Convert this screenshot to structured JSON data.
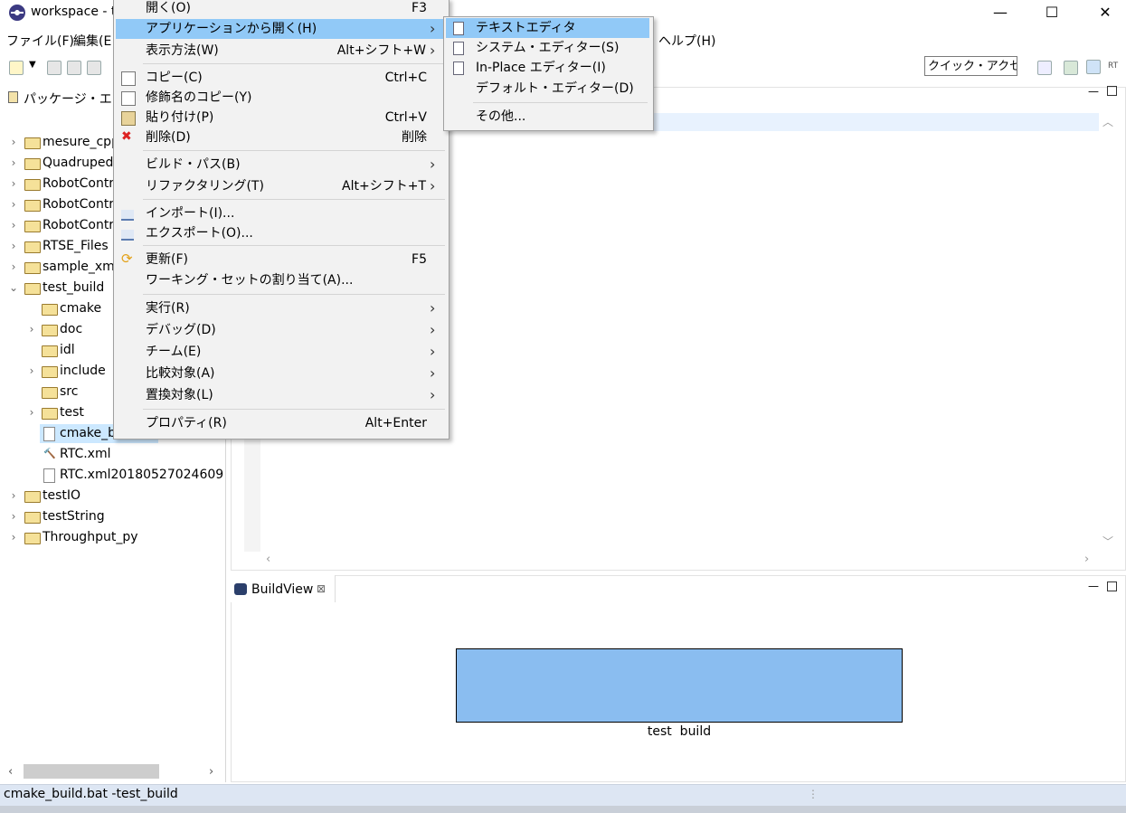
{
  "window": {
    "title": "workspace - t",
    "minimize": "—",
    "maximize": "☐",
    "close": "✕"
  },
  "menubar": {
    "items": [
      "ファイル(F)",
      "編集(E",
      "ヘルプ(H)"
    ]
  },
  "toolbar": {
    "quick_access": "クイック・アクセス"
  },
  "package_explorer": {
    "title": "パッケージ・エクス",
    "items": [
      {
        "label": "mesure_cpp",
        "type": "project"
      },
      {
        "label": "Quadruped",
        "type": "project"
      },
      {
        "label": "RobotContr",
        "type": "project"
      },
      {
        "label": "RobotContr",
        "type": "project"
      },
      {
        "label": "RobotContr",
        "type": "project"
      },
      {
        "label": "RTSE_Files",
        "type": "project"
      },
      {
        "label": "sample_xml",
        "type": "project"
      },
      {
        "label": "test_build",
        "type": "project-open"
      },
      {
        "label": "cmake",
        "type": "folder"
      },
      {
        "label": "doc",
        "type": "folder-collapsed"
      },
      {
        "label": "idl",
        "type": "folder"
      },
      {
        "label": "include",
        "type": "folder-collapsed"
      },
      {
        "label": "src",
        "type": "folder"
      },
      {
        "label": "test",
        "type": "folder-collapsed"
      },
      {
        "label": "cmake_build.bat",
        "type": "file-selected"
      },
      {
        "label": "RTC.xml",
        "type": "file-tool"
      },
      {
        "label": "RTC.xml20180527024609",
        "type": "file"
      },
      {
        "label": "testIO",
        "type": "project"
      },
      {
        "label": "testString",
        "type": "project"
      },
      {
        "label": "Throughput_py",
        "type": "project"
      }
    ]
  },
  "context_menu": {
    "items": [
      {
        "label": "開く(O)",
        "shortcut": "F3"
      },
      {
        "label": "アプリケーションから開く(H)",
        "shortcut": "",
        "submenu": true,
        "highlighted": true
      },
      {
        "label": "表示方法(W)",
        "shortcut": "Alt+シフト+W",
        "submenu": true
      },
      {
        "label": "コピー(C)",
        "shortcut": "Ctrl+C",
        "icon": "copy-icon"
      },
      {
        "label": "修飾名のコピー(Y)",
        "shortcut": "",
        "icon": "copy-qualified-icon"
      },
      {
        "label": "貼り付け(P)",
        "shortcut": "Ctrl+V",
        "icon": "paste-icon"
      },
      {
        "label": "削除(D)",
        "shortcut": "削除",
        "icon": "delete-icon"
      },
      {
        "label": "ビルド・パス(B)",
        "shortcut": "",
        "submenu": true
      },
      {
        "label": "リファクタリング(T)",
        "shortcut": "Alt+シフト+T",
        "submenu": true
      },
      {
        "label": "インポート(I)...",
        "shortcut": "",
        "icon": "import-icon"
      },
      {
        "label": "エクスポート(O)...",
        "shortcut": "",
        "icon": "export-icon"
      },
      {
        "label": "更新(F)",
        "shortcut": "F5",
        "icon": "refresh-icon"
      },
      {
        "label": "ワーキング・セットの割り当て(A)...",
        "shortcut": ""
      },
      {
        "label": "実行(R)",
        "shortcut": "",
        "submenu": true
      },
      {
        "label": "デバッグ(D)",
        "shortcut": "",
        "submenu": true
      },
      {
        "label": "チーム(E)",
        "shortcut": "",
        "submenu": true
      },
      {
        "label": "比較対象(A)",
        "shortcut": "",
        "submenu": true
      },
      {
        "label": "置換対象(L)",
        "shortcut": "",
        "submenu": true
      },
      {
        "label": "プロパティ(R)",
        "shortcut": "Alt+Enter"
      }
    ]
  },
  "submenu": {
    "items": [
      {
        "label": "テキストエディタ",
        "highlighted": true
      },
      {
        "label": "システム・エディター(S)"
      },
      {
        "label": "In-Place エディター(I)"
      },
      {
        "label": "デフォルト・エディター(D)"
      },
      {
        "label": "その他..."
      }
    ]
  },
  "build_view": {
    "tab_title": "BuildView",
    "box_label": "test  build",
    "box_color": "#8abdf0"
  },
  "status_bar": {
    "text": "cmake_build.bat -test_build"
  },
  "colors": {
    "menu_highlight": "#91c9f7",
    "status_bar": "#dde6f3"
  }
}
